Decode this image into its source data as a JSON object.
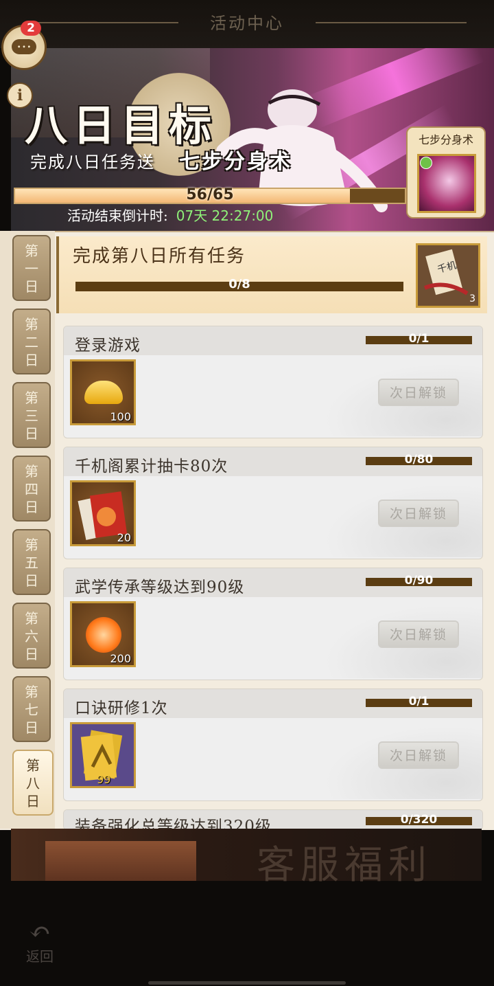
{
  "header": {
    "title": "活动中心"
  },
  "chat": {
    "badge": "2"
  },
  "banner": {
    "title": "八日目标",
    "subtitle_prefix": "完成八日任务送",
    "subtitle_skill": "七步分身术",
    "progress_text": "56/65",
    "progress_fraction": 0.86,
    "countdown_label": "活动结束倒计时:",
    "countdown_value": "07天 22:27:00",
    "reward_label": "七步分身术"
  },
  "days": [
    "第一日",
    "第二日",
    "第三日",
    "第四日",
    "第五日",
    "第六日",
    "第七日",
    "第八日"
  ],
  "active_day": 7,
  "summary_task": {
    "title": "完成第八日所有任务",
    "progress": "0/8",
    "reward_qty": "3"
  },
  "tasks": [
    {
      "name": "登录游戏",
      "progress": "0/1",
      "reward_qty": "100",
      "button": "次日解锁",
      "icon": "gold-ingot-icon"
    },
    {
      "name": "千机阁累计抽卡80次",
      "progress": "0/80",
      "reward_qty": "20",
      "button": "次日解锁",
      "icon": "card-pack-icon"
    },
    {
      "name": "武学传承等级达到90级",
      "progress": "0/90",
      "reward_qty": "200",
      "button": "次日解锁",
      "icon": "martial-coin-icon"
    },
    {
      "name": "口诀研修1次",
      "progress": "0/1",
      "reward_qty": "99",
      "button": "次日解锁",
      "icon": "technique-scroll-icon"
    },
    {
      "name": "装备强化总等级达到320级",
      "progress": "0/320"
    }
  ],
  "bottom_banner": {
    "text": "客服福利"
  },
  "back": {
    "label": "返回"
  },
  "colors": {
    "accent": "#8ff279",
    "bar": "#5b3d12",
    "gold_border": "#c89b3a"
  }
}
